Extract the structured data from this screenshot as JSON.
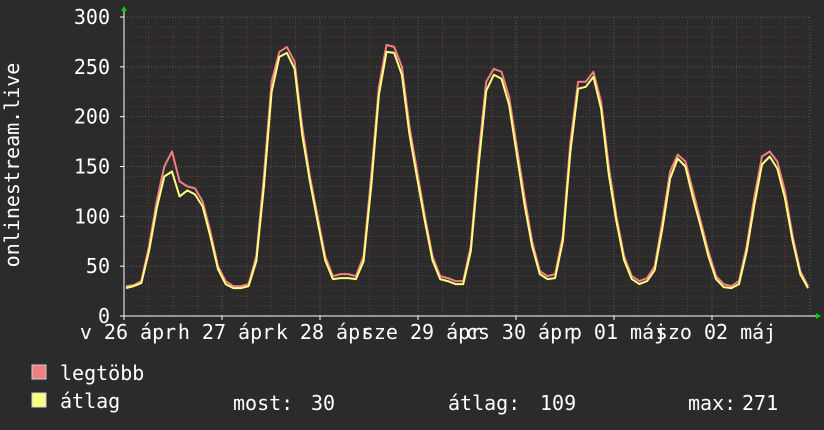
{
  "chart_data": {
    "type": "line",
    "title": "",
    "ylabel": "onlinestream.live",
    "xlabel": "",
    "ylim": [
      0,
      300
    ],
    "yticks": [
      0,
      50,
      100,
      150,
      200,
      250,
      300
    ],
    "xtick_labels": [
      "v 26 ápr",
      "h 27 ápr",
      "k 28 ápr",
      "sze 29 ápr",
      "cs 30 ápr",
      "p 01 máj",
      "szo 02 máj"
    ],
    "grid": true,
    "colors": {
      "background": "#2b2b2b",
      "plot_background": "#2b2b2b",
      "grid_major": "#595959",
      "grid_minor": "#6b3a3a",
      "axis": "#ffffff",
      "text": "#ffffff",
      "arrow": "#00d000"
    },
    "series": [
      {
        "name": "legtöbb",
        "color": "#f08080",
        "values": [
          30,
          31,
          35,
          70,
          115,
          150,
          165,
          135,
          130,
          128,
          115,
          85,
          50,
          35,
          30,
          30,
          32,
          60,
          140,
          235,
          265,
          270,
          255,
          190,
          140,
          100,
          60,
          40,
          42,
          42,
          40,
          60,
          140,
          230,
          272,
          270,
          250,
          190,
          145,
          100,
          60,
          40,
          38,
          35,
          35,
          70,
          160,
          235,
          248,
          245,
          220,
          170,
          120,
          75,
          45,
          40,
          42,
          80,
          175,
          235,
          235,
          245,
          215,
          150,
          100,
          60,
          40,
          35,
          38,
          50,
          95,
          145,
          162,
          155,
          125,
          95,
          65,
          40,
          32,
          30,
          35,
          70,
          120,
          160,
          165,
          155,
          125,
          80,
          45,
          30
        ]
      },
      {
        "name": "átlag",
        "color": "#ffff80",
        "values": [
          28,
          30,
          33,
          65,
          108,
          140,
          145,
          120,
          126,
          122,
          110,
          80,
          47,
          32,
          28,
          28,
          30,
          55,
          130,
          225,
          260,
          264,
          248,
          182,
          135,
          95,
          56,
          37,
          38,
          38,
          37,
          55,
          130,
          222,
          265,
          264,
          242,
          182,
          138,
          95,
          56,
          37,
          35,
          32,
          32,
          65,
          150,
          226,
          242,
          238,
          212,
          162,
          112,
          70,
          42,
          37,
          38,
          75,
          165,
          228,
          230,
          240,
          208,
          142,
          95,
          56,
          37,
          32,
          35,
          46,
          88,
          138,
          158,
          150,
          118,
          90,
          60,
          37,
          29,
          28,
          32,
          65,
          112,
          152,
          160,
          148,
          118,
          75,
          42,
          28
        ]
      }
    ],
    "stats": {
      "now_label": "most:",
      "now_value": "30",
      "avg_label": "átlag:",
      "avg_value": "109",
      "max_label": "max:",
      "max_value": "271"
    }
  }
}
